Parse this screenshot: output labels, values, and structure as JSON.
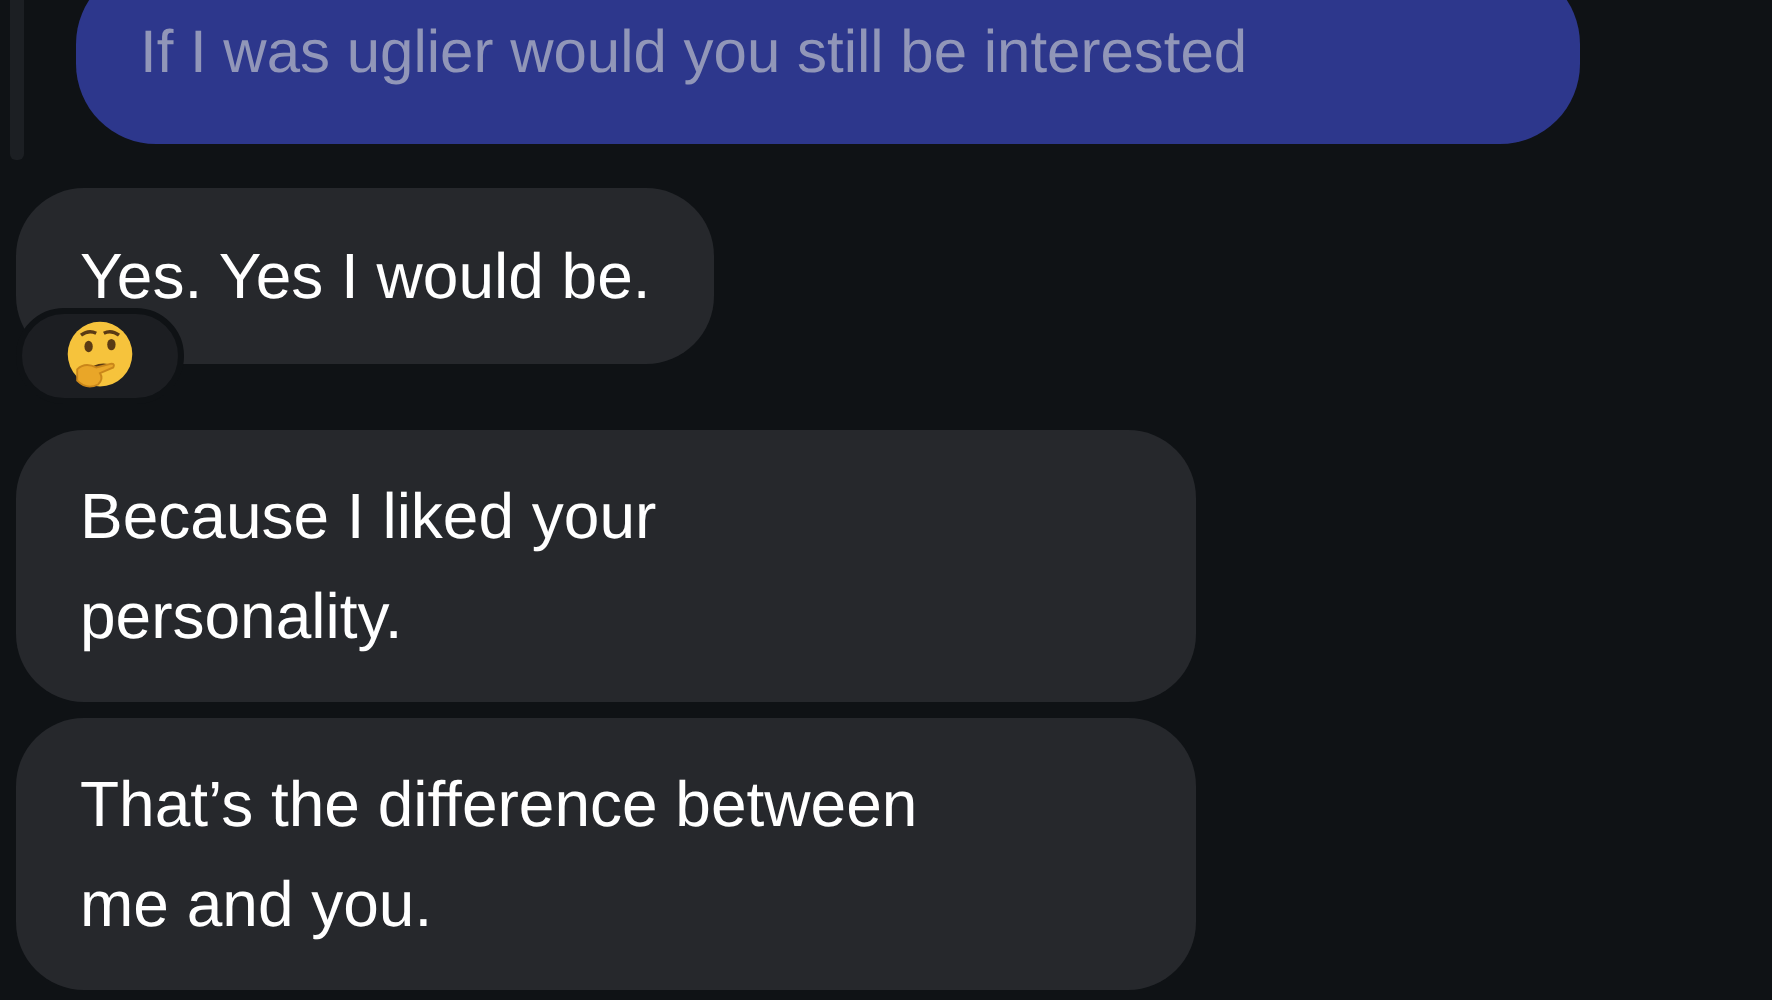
{
  "messages": [
    {
      "kind": "sent",
      "lines": [
        "If I was uglier would you still be interested"
      ],
      "has_reaction": false
    },
    {
      "kind": "received",
      "lines": [
        "Yes. Yes I would be."
      ],
      "has_reaction": true
    },
    {
      "kind": "received",
      "lines": [
        "Because I liked your",
        "personality."
      ],
      "has_reaction": false
    },
    {
      "kind": "received",
      "lines": [
        "That’s the difference between",
        "me and you."
      ],
      "has_reaction": false
    }
  ]
}
